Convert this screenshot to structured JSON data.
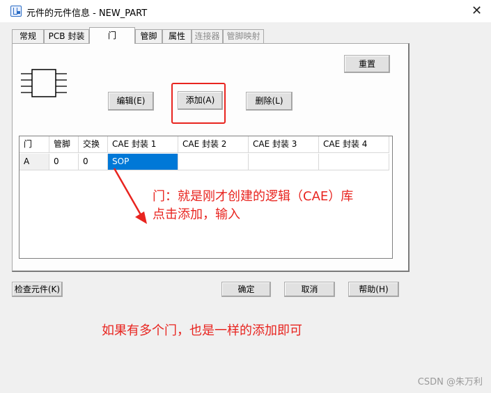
{
  "window": {
    "title": "元件的元件信息 - NEW_PART",
    "close_glyph": "✕"
  },
  "tabs": [
    {
      "label": "常规"
    },
    {
      "label": "PCB 封装"
    },
    {
      "label": "门"
    },
    {
      "label": "管脚"
    },
    {
      "label": "属性"
    },
    {
      "label": "连接器"
    },
    {
      "label": "管脚映射"
    }
  ],
  "active_tab": "门",
  "buttons": {
    "reset": "重置",
    "edit": "编辑(E)",
    "add": "添加(A)",
    "delete": "删除(L)",
    "check_part": "检查元件(K)",
    "ok": "确定",
    "cancel": "取消",
    "help": "帮助(H)"
  },
  "grid": {
    "columns": [
      "门",
      "管脚",
      "交换",
      "CAE 封装 1",
      "CAE 封装 2",
      "CAE 封装 3",
      "CAE 封装 4"
    ],
    "rows": [
      {
        "gate": "A",
        "pins": "0",
        "swap": "0",
        "cae1": "SOP",
        "cae2": "",
        "cae3": "",
        "cae4": ""
      }
    ]
  },
  "annotations": {
    "note1_line1": "门：就是刚才创建的逻辑（CAE）库",
    "note1_line2": "点击添加，输入",
    "note2": "如果有多个门，也是一样的添加即可",
    "color": "#e8241f"
  },
  "watermark": "CSDN @朱万利",
  "icons": {
    "app": "app-icon",
    "part_symbol": "ic-chip-icon",
    "arrow": "annotation-arrow-icon"
  }
}
